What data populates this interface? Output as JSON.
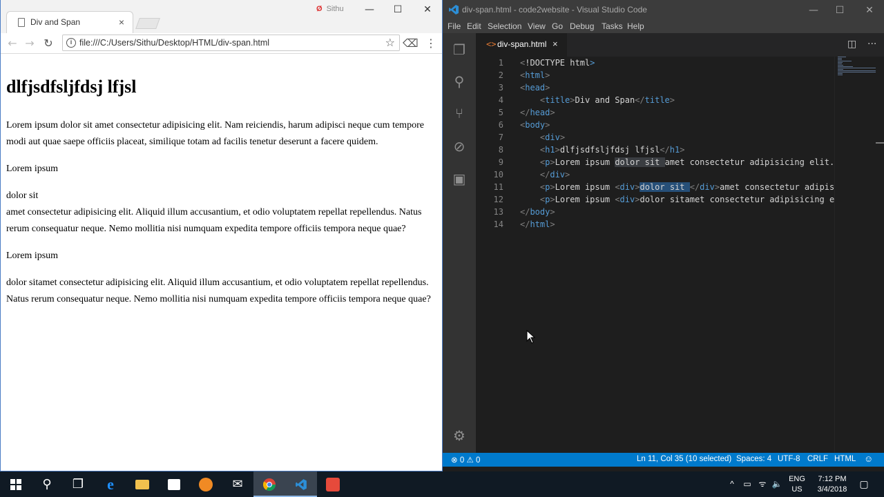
{
  "browser": {
    "tab_title": "Div and Span",
    "tab_close": "×",
    "profile_name": "Sithu",
    "window_controls": {
      "minimize": "—",
      "maximize": "☐",
      "close": "✕"
    },
    "nav": {
      "back": "←",
      "forward": "→",
      "reload": "↻",
      "menu": "⋮"
    },
    "url": "file:///C:/Users/Sithu/Desktop/HTML/div-span.html",
    "page": {
      "heading": "dlfjsdfsljfdsj lfjsl",
      "p1": "Lorem ipsum dolor sit amet consectetur adipisicing elit. Nam reiciendis, harum adipisci neque cum tempore modi aut quae saepe officiis placeat, similique totam ad facilis tenetur deserunt a facere quidem.",
      "p2": "Lorem ipsum",
      "div2": "dolor sit",
      "p2b": "amet consectetur adipisicing elit. Aliquid illum accusantium, et odio voluptatem repellat repellendus. Natus rerum consequatur neque. Nemo mollitia nisi numquam expedita tempore officiis tempora neque quae?",
      "p3": "Lorem ipsum",
      "div3": "dolor sitamet consectetur adipisicing elit. Aliquid illum accusantium, et odio voluptatem repellat repellendus. Natus rerum consequatur neque. Nemo mollitia nisi numquam expedita tempore officiis tempora neque quae?"
    }
  },
  "vscode": {
    "window_title": "div-span.html - code2website - Visual Studio Code",
    "menu": [
      "File",
      "Edit",
      "Selection",
      "View",
      "Go",
      "Debug",
      "Tasks",
      "Help"
    ],
    "tab": {
      "icon": "<>",
      "name": "div-span.html",
      "close": "×"
    },
    "tab_tools": {
      "split": "◫",
      "more": "···"
    },
    "activity": {
      "explorer": "❐",
      "search": "⚲",
      "scm": "⑂",
      "debug": "⊘",
      "extensions": "▣",
      "settings": "⚙"
    },
    "lines": [
      {
        "n": "1",
        "parts": [
          [
            "tag",
            "<"
          ],
          [
            "txt",
            "!DOCTYPE html"
          ],
          [
            "tag",
            ">"
          ]
        ]
      },
      {
        "n": "2",
        "parts": [
          [
            "tag",
            "<html>"
          ]
        ]
      },
      {
        "n": "3",
        "parts": [
          [
            "tag",
            "<head>"
          ]
        ]
      },
      {
        "n": "4",
        "parts": [
          [
            "txt",
            "    "
          ],
          [
            "tag",
            "<title>"
          ],
          [
            "txt",
            "Div and Span"
          ],
          [
            "tag",
            "</title>"
          ]
        ]
      },
      {
        "n": "5",
        "parts": [
          [
            "tag",
            "</head>"
          ]
        ]
      },
      {
        "n": "6",
        "parts": [
          [
            "tag",
            "<body>"
          ]
        ]
      },
      {
        "n": "7",
        "parts": [
          [
            "txt",
            "    "
          ],
          [
            "tag",
            "<div>"
          ]
        ]
      },
      {
        "n": "8",
        "parts": [
          [
            "txt",
            "    "
          ],
          [
            "tag",
            "<h1>"
          ],
          [
            "txt",
            "dlfjsdfsljfdsj lfjsl"
          ],
          [
            "tag",
            "</h1>"
          ]
        ]
      },
      {
        "n": "9",
        "parts": [
          [
            "txt",
            "    "
          ],
          [
            "tag",
            "<p>"
          ],
          [
            "txt",
            "Lorem ipsum "
          ],
          [
            "hl",
            "dolor sit "
          ],
          [
            "txt",
            "amet consectetur adipisicing elit."
          ]
        ]
      },
      {
        "n": "10",
        "parts": [
          [
            "txt",
            "    "
          ],
          [
            "tag",
            "</div>"
          ]
        ]
      },
      {
        "n": "11",
        "parts": [
          [
            "txt",
            "    "
          ],
          [
            "tag",
            "<p>"
          ],
          [
            "txt",
            "Lorem ipsum "
          ],
          [
            "tag",
            "<div>"
          ],
          [
            "sel",
            "dolor sit "
          ],
          [
            "tag",
            "</div>"
          ],
          [
            "txt",
            "amet consectetur adipis"
          ]
        ]
      },
      {
        "n": "12",
        "parts": [
          [
            "txt",
            "    "
          ],
          [
            "tag",
            "<p>"
          ],
          [
            "txt",
            "Lorem ipsum "
          ],
          [
            "tag",
            "<div>"
          ],
          [
            "txt",
            "dolor sitamet consectetur adipisicing e"
          ]
        ]
      },
      {
        "n": "13",
        "parts": [
          [
            "tag",
            "</body>"
          ]
        ]
      },
      {
        "n": "14",
        "parts": [
          [
            "tag",
            "</html>"
          ]
        ]
      }
    ],
    "status": {
      "errors": "0",
      "warnings": "0",
      "cursor": "Ln 11, Col 35 (10 selected)",
      "spaces": "Spaces: 4",
      "encoding": "UTF-8",
      "eol": "CRLF",
      "language": "HTML",
      "feedback": "☺"
    }
  },
  "taskbar": {
    "apps": [
      "start",
      "search",
      "task-view",
      "edge",
      "file-explorer",
      "store",
      "app-orange",
      "mail",
      "chrome",
      "vscode",
      "app-red"
    ],
    "language": "ENG",
    "region": "US",
    "time": "7:12 PM",
    "date": "3/4/2018",
    "colors": {
      "accent": "#007acc",
      "taskbar": "#101a24"
    }
  }
}
